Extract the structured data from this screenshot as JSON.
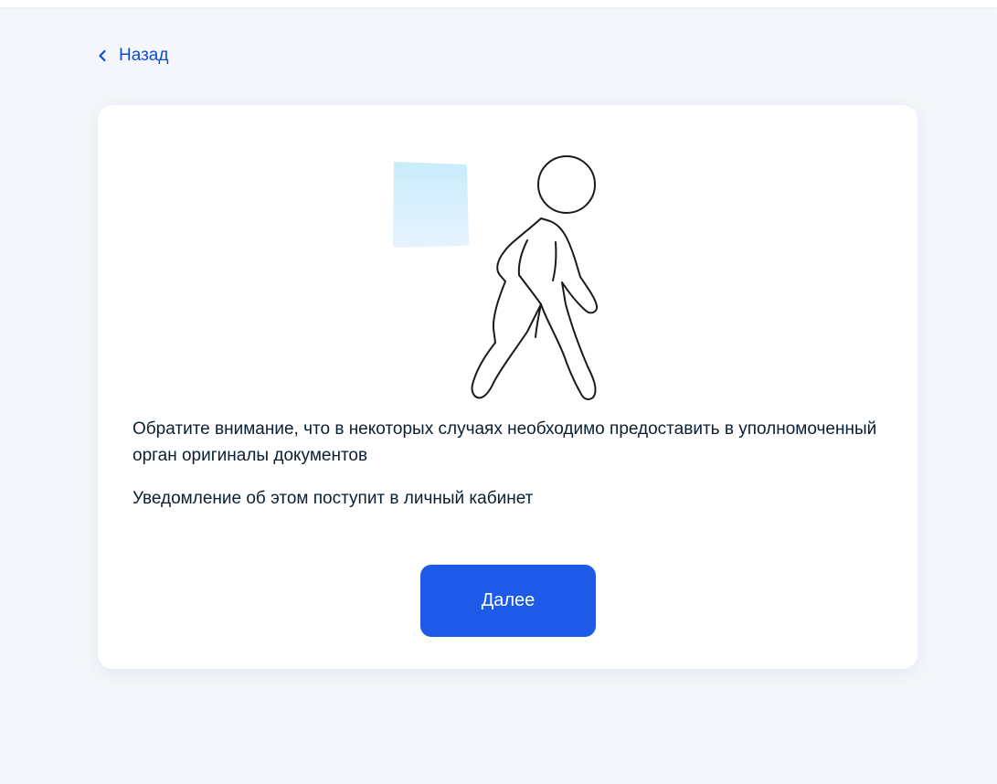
{
  "navigation": {
    "back_label": "Назад"
  },
  "notice": {
    "paragraph_1": "Обратите внимание, что в некоторых случаях необходимо предоставить в уполномоченный орган оригиналы документов",
    "paragraph_2": "Уведомление об этом поступит в личный кабинет"
  },
  "actions": {
    "next_label": "Далее"
  },
  "icons": {
    "back": "chevron-left-icon",
    "illustration": "walking-person-icon"
  },
  "colors": {
    "accent": "#0d4cd3",
    "button": "#1e5ae8",
    "text": "#0b1f33",
    "background": "#f4f6fb"
  }
}
